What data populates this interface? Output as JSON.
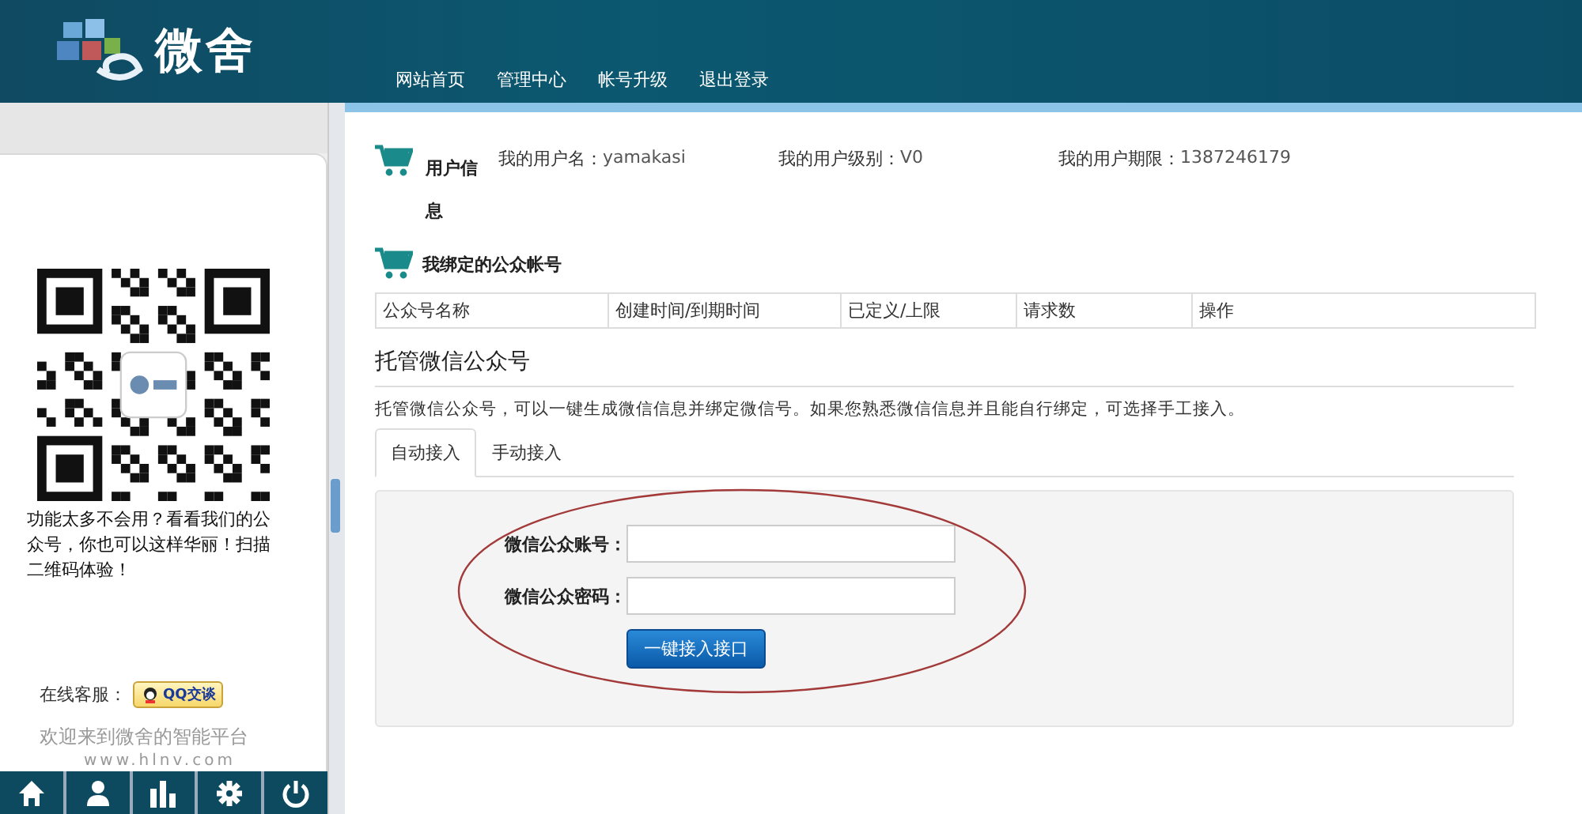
{
  "header": {
    "logo_text": "微舍",
    "nav": [
      {
        "label": "网站首页"
      },
      {
        "label": "管理中心"
      },
      {
        "label": "帐号升级"
      },
      {
        "label": "退出登录"
      }
    ]
  },
  "sidebar": {
    "qr_caption": "功能太多不会用？看看我们的公众号，你也可以这样华丽！扫描二维码体验！",
    "service_label": "在线客服：",
    "qq_button": "QQ交谈",
    "welcome": "欢迎来到微舍的智能平台",
    "website": "www.hlnv.com",
    "toolbar": [
      {
        "kind": "home"
      },
      {
        "kind": "user"
      },
      {
        "kind": "chart"
      },
      {
        "kind": "settings"
      },
      {
        "kind": "power"
      }
    ]
  },
  "user_info": {
    "title": "用户信息",
    "fields": [
      {
        "label": "我的用户名：",
        "value": "yamakasi"
      },
      {
        "label": "我的用户级别：",
        "value": "V0"
      },
      {
        "label": "我的用户期限：",
        "value": "1387246179"
      }
    ]
  },
  "bound_accounts": {
    "title": "我绑定的公众帐号",
    "columns": [
      "公众号名称",
      "创建时间/到期时间",
      "已定义/上限",
      "请求数",
      "操作"
    ]
  },
  "hosting": {
    "title": "托管微信公众号",
    "description": "托管微信公众号，可以一键生成微信信息并绑定微信号。如果您熟悉微信信息并且能自行绑定，可选择手工接入。",
    "tabs": [
      {
        "label": "自动接入",
        "selected": true
      },
      {
        "label": "手动接入",
        "selected": false
      }
    ],
    "fields": [
      {
        "label": "微信公众账号："
      },
      {
        "label": "微信公众密码："
      }
    ],
    "submit": "一键接入接口"
  }
}
